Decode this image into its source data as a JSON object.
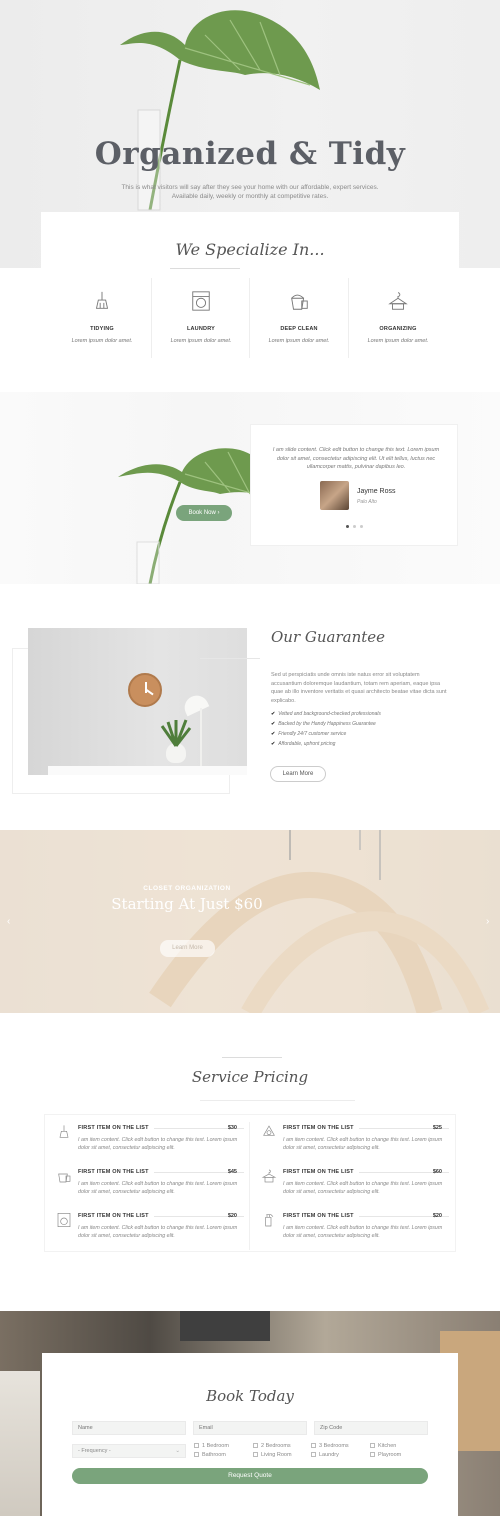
{
  "hero": {
    "title": "Organized & Tidy",
    "subtitle_line1": "This is what visitors will say after they see your home with our affordable, expert services.",
    "subtitle_line2": "Available daily, weekly or monthly at competitive rates."
  },
  "specialize": {
    "title": "We Specialize In...",
    "services": [
      {
        "name": "TIDYING",
        "desc": "Lorem ipsum dolor amet.",
        "icon": "broom-icon"
      },
      {
        "name": "LAUNDRY",
        "desc": "Lorem ipsum dolor amet.",
        "icon": "washing-machine-icon"
      },
      {
        "name": "DEEP CLEAN",
        "desc": "Lorem ipsum dolor amet.",
        "icon": "bucket-icon"
      },
      {
        "name": "ORGANIZING",
        "desc": "Lorem ipsum dolor amet.",
        "icon": "hanger-icon"
      }
    ]
  },
  "testimonial": {
    "text": "I am slide content. Click edit button to change this text. Lorem ipsum dolor sit amet, consectetur adipiscing elit. Ut elit tellus, luctus nec ullamcorper mattis, pulvinar dapibus leo.",
    "author": "Jayme Ross",
    "location": "Palo Alto",
    "book_now": "Book Now",
    "book_now_arrow": "›"
  },
  "guarantee": {
    "title": "Our Guarantee",
    "body": "Sed ut perspiciatis unde omnis iste natus error sit voluptatem accusantium doloremque laudantium, totam rem aperiam, eaque ipsa quae ab illo inventore veritatis et quasi architecto beatae vitae dicta sunt explicabo.",
    "checks": [
      "Vetted and background-checked professionals",
      "Backed by the Handy Happiness Guarantee",
      "Friendly 24/7 customer service",
      "Affordable, upfront pricing"
    ],
    "check_mark": "✔",
    "learn_more": "Learn More"
  },
  "promo": {
    "eyebrow": "CLOSET ORGANIZATION",
    "title": "Starting At Just $60",
    "button": "Learn More",
    "prev_arrow": "‹",
    "next_arrow": "›"
  },
  "pricing": {
    "title": "Service Pricing",
    "items": [
      {
        "name": "FIRST ITEM ON THE LIST",
        "price": "$30",
        "desc": "I am item content. Click edit button to change this text. Lorem ipsum dolor sit amet, consectetur adipiscing elit.",
        "icon": "broom-icon"
      },
      {
        "name": "FIRST ITEM ON THE LIST",
        "price": "$25",
        "desc": "I am item content. Click edit button to change this text. Lorem ipsum dolor sit amet, consectetur adipiscing elit.",
        "icon": "recycle-icon"
      },
      {
        "name": "FIRST ITEM ON THE LIST",
        "price": "$45",
        "desc": "I am item content. Click edit button to change this text. Lorem ipsum dolor sit amet, consectetur adipiscing elit.",
        "icon": "bucket-icon"
      },
      {
        "name": "FIRST ITEM ON THE LIST",
        "price": "$60",
        "desc": "I am item content. Click edit button to change this text. Lorem ipsum dolor sit amet, consectetur adipiscing elit.",
        "icon": "shirt-hanger-icon"
      },
      {
        "name": "FIRST ITEM ON THE LIST",
        "price": "$20",
        "desc": "I am item content. Click edit button to change this text. Lorem ipsum dolor sit amet, consectetur adipiscing elit.",
        "icon": "washing-machine-icon"
      },
      {
        "name": "FIRST ITEM ON THE LIST",
        "price": "$20",
        "desc": "I am item content. Click edit button to change this text. Lorem ipsum dolor sit amet, consectetur adipiscing elit.",
        "icon": "spray-bottle-icon"
      }
    ]
  },
  "booking": {
    "title": "Book Today",
    "name_placeholder": "Name",
    "email_placeholder": "Email",
    "zip_placeholder": "Zip Code",
    "frequency": "- Frequency -",
    "frequency_caret": "⌄",
    "checkboxes": [
      "1 Bedroom",
      "2 Bedrooms",
      "3 Bedrooms",
      "Kitchen",
      "Bathroom",
      "Living Room",
      "Laundry",
      "Playroom"
    ],
    "submit": "Request Quote"
  },
  "colors": {
    "accent_green": "#7aa47c",
    "heading_gray": "#5c5f66"
  }
}
